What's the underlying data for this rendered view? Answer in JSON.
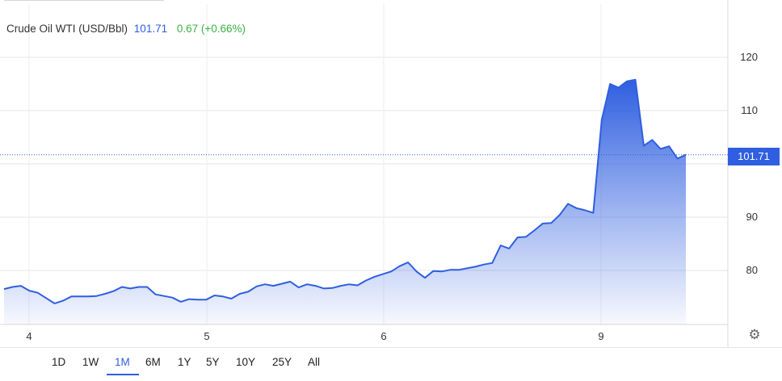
{
  "header": {
    "name": "Crude Oil WTI (USD/Bbl)",
    "price": "101.71",
    "change": "0.67 (+0.66%)"
  },
  "price_tag": "101.71",
  "range_selector": {
    "options": [
      "1D",
      "1W",
      "1M",
      "6M",
      "1Y",
      "5Y",
      "10Y",
      "25Y",
      "All"
    ],
    "active": "1M"
  },
  "colors": {
    "line": "#2f5fe0",
    "positive": "#3cb043"
  },
  "icons": {
    "settings": "gear-icon"
  },
  "chart_data": {
    "type": "area",
    "title": "Crude Oil WTI (USD/Bbl)",
    "xlabel": "",
    "ylabel": "",
    "ylim": [
      70,
      130
    ],
    "y_ticks": [
      80,
      90,
      110,
      120
    ],
    "x_ticks": [
      "4",
      "5",
      "6",
      "9"
    ],
    "last_value": 101.71,
    "grid": true,
    "series": [
      {
        "values": [
          76.5,
          76.9,
          77.1,
          76.2,
          75.8,
          74.8,
          73.8,
          74.3,
          75.1,
          75.1,
          75.1,
          75.2,
          75.6,
          76.1,
          76.9,
          76.6,
          76.9,
          76.9,
          75.5,
          75.2,
          74.9,
          74.1,
          74.6,
          74.5,
          74.5,
          75.3,
          75.1,
          74.7,
          75.6,
          76.0,
          77.0,
          77.4,
          77.1,
          77.5,
          77.9,
          76.8,
          77.4,
          77.1,
          76.6,
          76.7,
          77.1,
          77.4,
          77.2,
          78.1,
          78.8,
          79.3,
          79.8,
          80.8,
          81.5,
          79.8,
          78.6,
          79.9,
          79.8,
          80.1,
          80.1,
          80.4,
          80.7,
          81.1,
          81.4,
          84.7,
          84.1,
          86.2,
          86.3,
          87.5,
          88.8,
          88.9,
          90.4,
          92.5,
          91.7,
          91.3,
          90.8,
          108.2,
          115.0,
          114.3,
          115.5,
          115.8,
          103.4,
          104.5,
          102.8,
          103.3,
          101.0,
          101.71
        ]
      }
    ]
  }
}
